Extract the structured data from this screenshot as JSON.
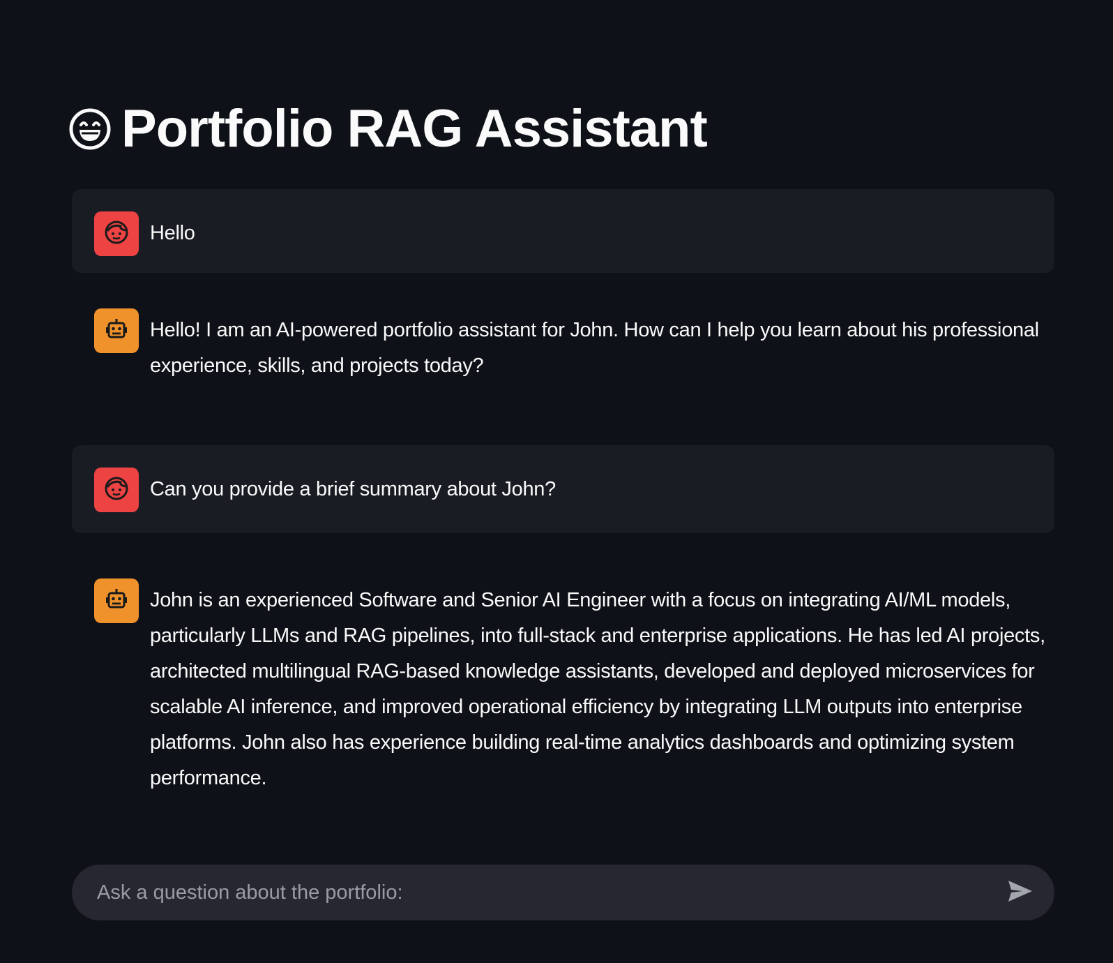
{
  "header": {
    "title": "Portfolio RAG Assistant",
    "icon": "grinning-face-icon"
  },
  "messages": [
    {
      "role": "user",
      "avatar_icon": "user-face-icon",
      "text": "Hello"
    },
    {
      "role": "assistant",
      "avatar_icon": "robot-icon",
      "text": "Hello! I am an AI-powered portfolio assistant for John. How can I help you learn about his professional experience, skills, and projects today?"
    },
    {
      "role": "user",
      "avatar_icon": "user-face-icon",
      "text": "Can you provide a brief summary about John?"
    },
    {
      "role": "assistant",
      "avatar_icon": "robot-icon",
      "text": "John is an experienced Software and Senior AI Engineer with a focus on integrating AI/ML models, particularly LLMs and RAG pipelines, into full-stack and enterprise applications. He has led AI projects, architected multilingual RAG-based knowledge assistants, developed and deployed microservices for scalable AI inference, and improved operational efficiency by integrating LLM outputs into enterprise platforms. John also has experience building real-time analytics dashboards and optimizing system performance."
    }
  ],
  "chat_input": {
    "placeholder": "Ask a question about the portfolio:",
    "value": "",
    "send_icon": "send-icon"
  },
  "colors": {
    "background": "#0e1117",
    "user_bubble": "#1a1c24",
    "user_avatar": "#ee4343",
    "assistant_avatar": "#f0922b",
    "input_bg": "#262730"
  }
}
